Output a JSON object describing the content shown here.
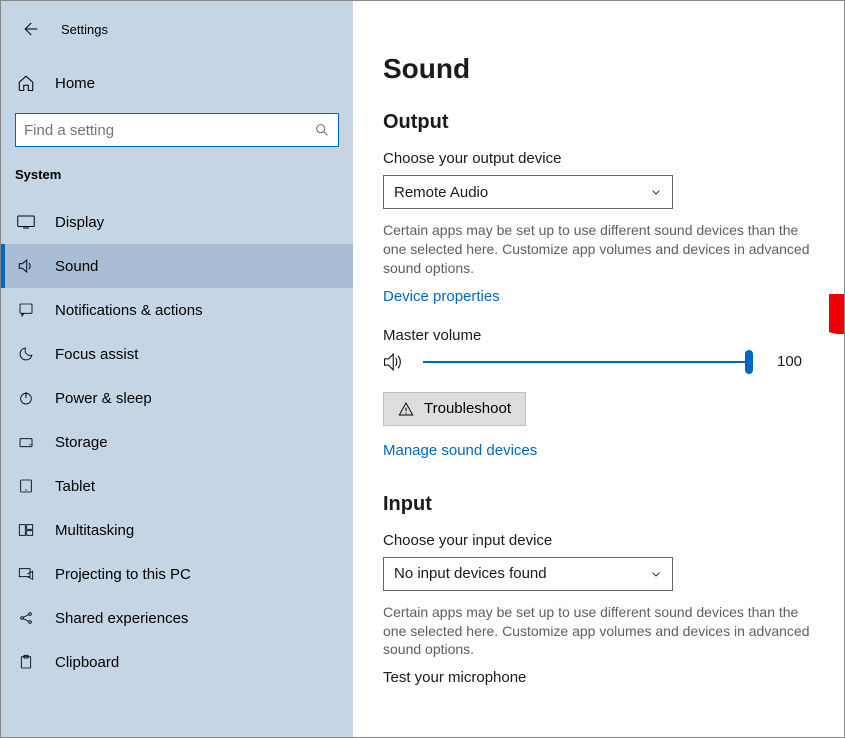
{
  "header": {
    "app_title": "Settings"
  },
  "sidebar": {
    "home_label": "Home",
    "search_placeholder": "Find a setting",
    "section_label": "System",
    "items": [
      {
        "label": "Display"
      },
      {
        "label": "Sound"
      },
      {
        "label": "Notifications & actions"
      },
      {
        "label": "Focus assist"
      },
      {
        "label": "Power & sleep"
      },
      {
        "label": "Storage"
      },
      {
        "label": "Tablet"
      },
      {
        "label": "Multitasking"
      },
      {
        "label": "Projecting to this PC"
      },
      {
        "label": "Shared experiences"
      },
      {
        "label": "Clipboard"
      }
    ]
  },
  "main": {
    "page_title": "Sound",
    "output": {
      "heading": "Output",
      "choose_label": "Choose your output device",
      "selected": "Remote Audio",
      "helper": "Certain apps may be set up to use different sound devices than the one selected here. Customize app volumes and devices in advanced sound options.",
      "device_properties": "Device properties",
      "master_label": "Master volume",
      "volume_value": "100",
      "troubleshoot": "Troubleshoot",
      "manage": "Manage sound devices"
    },
    "input": {
      "heading": "Input",
      "choose_label": "Choose your input device",
      "selected": "No input devices found",
      "helper": "Certain apps may be set up to use different sound devices than the one selected here. Customize app volumes and devices in advanced sound options.",
      "test_label": "Test your microphone"
    }
  }
}
